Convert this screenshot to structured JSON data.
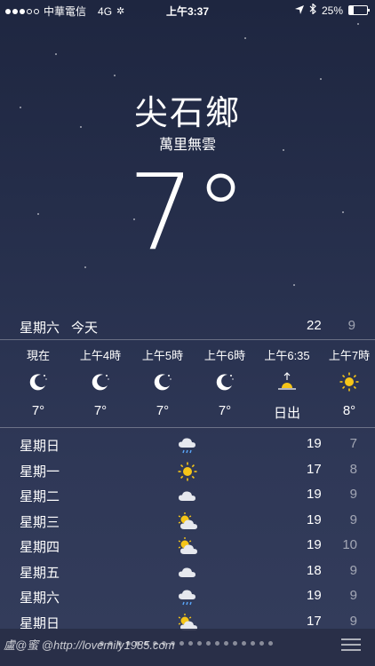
{
  "status_bar": {
    "carrier": "中華電信",
    "network": "4G",
    "time": "上午3:37",
    "battery": "25%",
    "battery_level": 0.25,
    "signal_bars_filled": 3,
    "signal_bars_total": 5
  },
  "header": {
    "location": "尖石鄉",
    "condition": "萬里無雲",
    "temperature": "7°"
  },
  "today": {
    "day": "星期六",
    "label": "今天",
    "high": "22",
    "low": "9"
  },
  "hourly": [
    {
      "time": "現在",
      "icon": "moon-icon",
      "value": "7°"
    },
    {
      "time": "上午4時",
      "icon": "moon-icon",
      "value": "7°"
    },
    {
      "time": "上午5時",
      "icon": "moon-icon",
      "value": "7°"
    },
    {
      "time": "上午6時",
      "icon": "moon-icon",
      "value": "7°"
    },
    {
      "time": "上午6:35",
      "icon": "sunrise-icon",
      "value": "日出"
    },
    {
      "time": "上午7時",
      "icon": "sun-icon",
      "value": "8°"
    }
  ],
  "daily": [
    {
      "day": "星期日",
      "icon": "rain-cloud-icon",
      "high": "19",
      "low": "7"
    },
    {
      "day": "星期一",
      "icon": "sun-icon",
      "high": "17",
      "low": "8"
    },
    {
      "day": "星期二",
      "icon": "cloud-icon",
      "high": "19",
      "low": "9"
    },
    {
      "day": "星期三",
      "icon": "partly-cloudy-icon",
      "high": "19",
      "low": "9"
    },
    {
      "day": "星期四",
      "icon": "partly-cloudy-icon",
      "high": "19",
      "low": "10"
    },
    {
      "day": "星期五",
      "icon": "cloud-icon",
      "high": "18",
      "low": "9"
    },
    {
      "day": "星期六",
      "icon": "rain-cloud-icon",
      "high": "19",
      "low": "9"
    },
    {
      "day": "星期日",
      "icon": "partly-cloudy-icon",
      "high": "17",
      "low": "9"
    }
  ],
  "watermark": "盧@蜜 @http://lovemily1985.com",
  "page_dot_count": 20,
  "colors": {
    "sun": "#f5c518",
    "background_top": "#1e2640",
    "background_bottom": "#343d5c"
  }
}
